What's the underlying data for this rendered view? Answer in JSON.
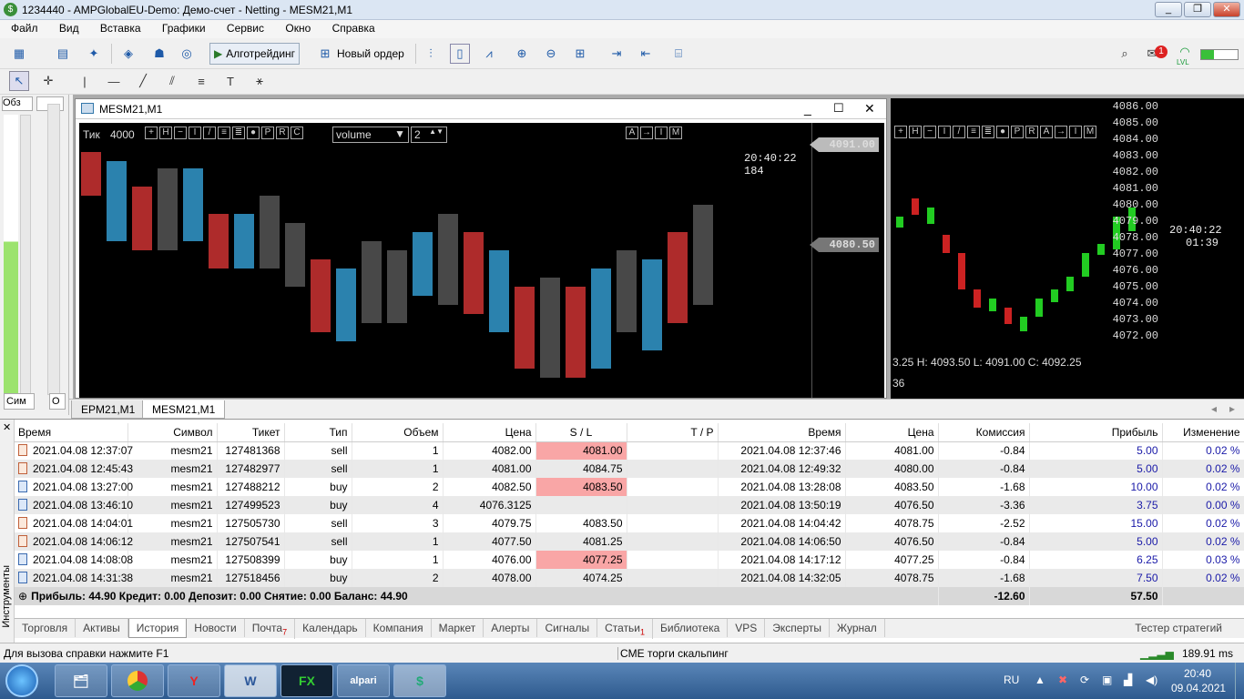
{
  "window": {
    "title": "1234440 - AMPGlobalEU-Demo: Демо-счет - Netting - MESM21,M1",
    "logo": "$"
  },
  "menu": [
    "Файл",
    "Вид",
    "Вставка",
    "Графики",
    "Сервис",
    "Окно",
    "Справка"
  ],
  "toolbar": {
    "algo_label": "Алготрейдинг",
    "order_label": "Новый ордер",
    "notify_count": "1",
    "lvl_label": "LVL"
  },
  "left_panel": {
    "tab1": "Обз",
    "tab2": "Сим",
    "tab3": "О"
  },
  "chart1": {
    "title": "MESM21,M1",
    "tick_label": "Тик",
    "tick_value": "4000",
    "volume_select": "volume",
    "volume_num": "2",
    "time": "20:40:22",
    "time_sub": "184",
    "price_labels": [
      "4091.00",
      "4080.50"
    ]
  },
  "chart2": {
    "time": "20:40:22",
    "countdown": "01:39",
    "ohlc": "3.25  H: 4093.50  L: 4091.00  C: 4092.25",
    "bottom_num": "36",
    "axis": [
      "4086.00",
      "4085.00",
      "4084.00",
      "4083.00",
      "4082.00",
      "4081.00",
      "4080.00",
      "4079.00",
      "4078.00",
      "4077.00",
      "4076.00",
      "4075.00",
      "4074.00",
      "4073.00",
      "4072.00"
    ]
  },
  "chart_tabs": [
    "EPM21,M1",
    "MESM21,M1"
  ],
  "history": {
    "headers": [
      "Время",
      "Символ",
      "Тикет",
      "Тип",
      "Объем",
      "Цена",
      "S / L",
      "T / P",
      "Время",
      "Цена",
      "Комиссия",
      "Прибыль",
      "Изменение"
    ],
    "rows": [
      [
        "2021.04.08 12:37:07",
        "mesm21",
        "127481368",
        "sell",
        "1",
        "4082.00",
        "4081.00",
        "",
        "2021.04.08 12:37:46",
        "4081.00",
        "-0.84",
        "5.00",
        "0.02 %"
      ],
      [
        "2021.04.08 12:45:43",
        "mesm21",
        "127482977",
        "sell",
        "1",
        "4081.00",
        "4084.75",
        "",
        "2021.04.08 12:49:32",
        "4080.00",
        "-0.84",
        "5.00",
        "0.02 %"
      ],
      [
        "2021.04.08 13:27:00",
        "mesm21",
        "127488212",
        "buy",
        "2",
        "4082.50",
        "4083.50",
        "",
        "2021.04.08 13:28:08",
        "4083.50",
        "-1.68",
        "10.00",
        "0.02 %"
      ],
      [
        "2021.04.08 13:46:10",
        "mesm21",
        "127499523",
        "buy",
        "4",
        "4076.3125",
        "",
        "",
        "2021.04.08 13:50:19",
        "4076.50",
        "-3.36",
        "3.75",
        "0.00 %"
      ],
      [
        "2021.04.08 14:04:01",
        "mesm21",
        "127505730",
        "sell",
        "3",
        "4079.75",
        "4083.50",
        "",
        "2021.04.08 14:04:42",
        "4078.75",
        "-2.52",
        "15.00",
        "0.02 %"
      ],
      [
        "2021.04.08 14:06:12",
        "mesm21",
        "127507541",
        "sell",
        "1",
        "4077.50",
        "4081.25",
        "",
        "2021.04.08 14:06:50",
        "4076.50",
        "-0.84",
        "5.00",
        "0.02 %"
      ],
      [
        "2021.04.08 14:08:08",
        "mesm21",
        "127508399",
        "buy",
        "1",
        "4076.00",
        "4077.25",
        "",
        "2021.04.08 14:17:12",
        "4077.25",
        "-0.84",
        "6.25",
        "0.03 %"
      ],
      [
        "2021.04.08 14:31:38",
        "mesm21",
        "127518456",
        "buy",
        "2",
        "4078.00",
        "4074.25",
        "",
        "2021.04.08 14:32:05",
        "4078.75",
        "-1.68",
        "7.50",
        "0.02 %"
      ]
    ],
    "summary": "Прибыль: 44.90  Кредит: 0.00  Депозит: 0.00  Снятие: 0.00  Баланс: 44.90",
    "summary_commission": "-12.60",
    "summary_profit": "57.50"
  },
  "terminal_side_label": "Инструменты",
  "terminal_tabs": [
    "Торговля",
    "Активы",
    "История",
    "Новости",
    "Почта",
    "Календарь",
    "Компания",
    "Маркет",
    "Алерты",
    "Сигналы",
    "Статьи",
    "Библиотека",
    "VPS",
    "Эксперты",
    "Журнал"
  ],
  "mail_badge": "7",
  "articles_badge": "1",
  "tester_label": "Тестер стратегий",
  "status": {
    "help": "Для вызова справки нажмите F1",
    "profile": "CME торги скальпинг",
    "ping": "189.91 ms"
  },
  "taskbar": {
    "lang": "RU",
    "time": "20:40",
    "date": "09.04.2021",
    "apps": [
      "",
      "",
      "Y",
      "W",
      "FX",
      "alpari",
      "$"
    ]
  }
}
